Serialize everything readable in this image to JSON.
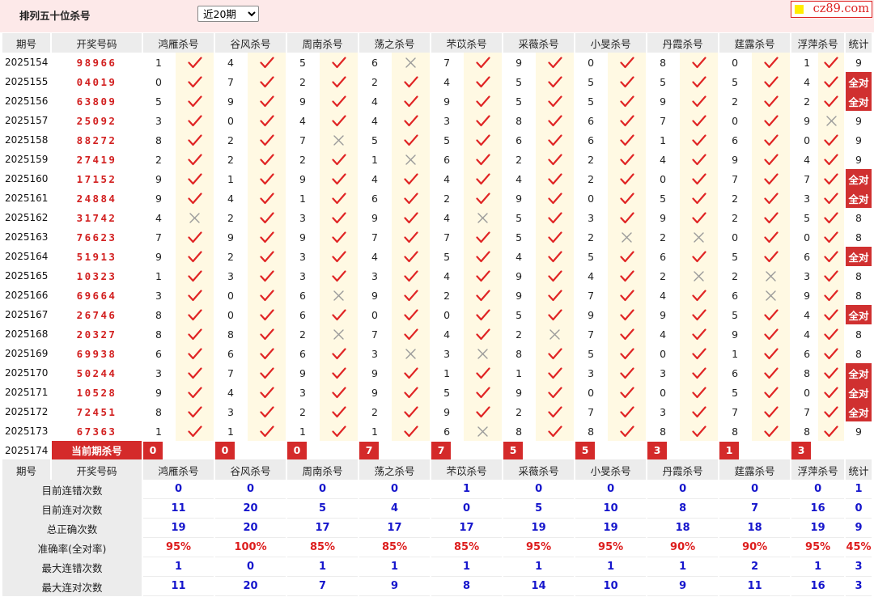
{
  "header": {
    "title": "排列五十位杀号",
    "range_select": "近20期",
    "logo": "cz89.com"
  },
  "table": {
    "col_qihao": "期号",
    "col_kaijiang": "开奖号码",
    "experts": [
      "鸿雁杀号",
      "谷风杀号",
      "周南杀号",
      "荡之杀号",
      "芣苡杀号",
      "采薇杀号",
      "小旻杀号",
      "丹霞杀号",
      "莛露杀号",
      "浮萍杀号"
    ],
    "col_stat": "统计",
    "all_correct_label": "全对",
    "rows": [
      {
        "issue": "2025154",
        "draw": "98966",
        "kills": [
          1,
          4,
          5,
          6,
          7,
          9,
          0,
          8,
          0,
          1
        ],
        "ok": [
          1,
          1,
          1,
          0,
          1,
          1,
          1,
          1,
          1,
          1
        ],
        "stat": "9"
      },
      {
        "issue": "2025155",
        "draw": "04019",
        "kills": [
          0,
          7,
          2,
          2,
          4,
          5,
          5,
          5,
          5,
          4
        ],
        "ok": [
          1,
          1,
          1,
          1,
          1,
          1,
          1,
          1,
          1,
          1
        ],
        "stat": "全对"
      },
      {
        "issue": "2025156",
        "draw": "63809",
        "kills": [
          5,
          9,
          9,
          4,
          9,
          5,
          5,
          9,
          2,
          2
        ],
        "ok": [
          1,
          1,
          1,
          1,
          1,
          1,
          1,
          1,
          1,
          1
        ],
        "stat": "全对"
      },
      {
        "issue": "2025157",
        "draw": "25092",
        "kills": [
          3,
          0,
          4,
          4,
          3,
          8,
          6,
          7,
          0,
          9
        ],
        "ok": [
          1,
          1,
          1,
          1,
          1,
          1,
          1,
          1,
          1,
          0
        ],
        "stat": "9"
      },
      {
        "issue": "2025158",
        "draw": "88272",
        "kills": [
          8,
          2,
          7,
          5,
          5,
          6,
          6,
          1,
          6,
          0
        ],
        "ok": [
          1,
          1,
          0,
          1,
          1,
          1,
          1,
          1,
          1,
          1
        ],
        "stat": "9"
      },
      {
        "issue": "2025159",
        "draw": "27419",
        "kills": [
          2,
          2,
          2,
          1,
          6,
          2,
          2,
          4,
          9,
          4
        ],
        "ok": [
          1,
          1,
          1,
          0,
          1,
          1,
          1,
          1,
          1,
          1
        ],
        "stat": "9"
      },
      {
        "issue": "2025160",
        "draw": "17152",
        "kills": [
          9,
          1,
          9,
          4,
          4,
          4,
          2,
          0,
          7,
          7
        ],
        "ok": [
          1,
          1,
          1,
          1,
          1,
          1,
          1,
          1,
          1,
          1
        ],
        "stat": "全对"
      },
      {
        "issue": "2025161",
        "draw": "24884",
        "kills": [
          9,
          4,
          1,
          6,
          2,
          9,
          0,
          5,
          2,
          3
        ],
        "ok": [
          1,
          1,
          1,
          1,
          1,
          1,
          1,
          1,
          1,
          1
        ],
        "stat": "全对"
      },
      {
        "issue": "2025162",
        "draw": "31742",
        "kills": [
          4,
          2,
          3,
          9,
          4,
          5,
          3,
          9,
          2,
          5
        ],
        "ok": [
          0,
          1,
          1,
          1,
          0,
          1,
          1,
          1,
          1,
          1
        ],
        "stat": "8"
      },
      {
        "issue": "2025163",
        "draw": "76623",
        "kills": [
          7,
          9,
          9,
          7,
          7,
          5,
          2,
          2,
          0,
          0
        ],
        "ok": [
          1,
          1,
          1,
          1,
          1,
          1,
          0,
          0,
          1,
          1
        ],
        "stat": "8"
      },
      {
        "issue": "2025164",
        "draw": "51913",
        "kills": [
          9,
          2,
          3,
          4,
          5,
          4,
          5,
          6,
          5,
          6
        ],
        "ok": [
          1,
          1,
          1,
          1,
          1,
          1,
          1,
          1,
          1,
          1
        ],
        "stat": "全对"
      },
      {
        "issue": "2025165",
        "draw": "10323",
        "kills": [
          1,
          3,
          3,
          3,
          4,
          9,
          4,
          2,
          2,
          3
        ],
        "ok": [
          1,
          1,
          1,
          1,
          1,
          1,
          1,
          0,
          0,
          1
        ],
        "stat": "8"
      },
      {
        "issue": "2025166",
        "draw": "69664",
        "kills": [
          3,
          0,
          6,
          9,
          2,
          9,
          7,
          4,
          6,
          9
        ],
        "ok": [
          1,
          1,
          0,
          1,
          1,
          1,
          1,
          1,
          0,
          1
        ],
        "stat": "8"
      },
      {
        "issue": "2025167",
        "draw": "26746",
        "kills": [
          8,
          0,
          6,
          0,
          0,
          5,
          9,
          9,
          5,
          4
        ],
        "ok": [
          1,
          1,
          1,
          1,
          1,
          1,
          1,
          1,
          1,
          1
        ],
        "stat": "全对"
      },
      {
        "issue": "2025168",
        "draw": "20327",
        "kills": [
          8,
          8,
          2,
          7,
          4,
          2,
          7,
          4,
          9,
          4
        ],
        "ok": [
          1,
          1,
          0,
          1,
          1,
          0,
          1,
          1,
          1,
          1
        ],
        "stat": "8"
      },
      {
        "issue": "2025169",
        "draw": "69938",
        "kills": [
          6,
          6,
          6,
          3,
          3,
          8,
          5,
          0,
          1,
          6
        ],
        "ok": [
          1,
          1,
          1,
          0,
          0,
          1,
          1,
          1,
          1,
          1
        ],
        "stat": "8"
      },
      {
        "issue": "2025170",
        "draw": "50244",
        "kills": [
          3,
          7,
          9,
          9,
          1,
          1,
          3,
          3,
          6,
          8
        ],
        "ok": [
          1,
          1,
          1,
          1,
          1,
          1,
          1,
          1,
          1,
          1
        ],
        "stat": "全对"
      },
      {
        "issue": "2025171",
        "draw": "10528",
        "kills": [
          9,
          4,
          3,
          9,
          5,
          9,
          0,
          0,
          5,
          0
        ],
        "ok": [
          1,
          1,
          1,
          1,
          1,
          1,
          1,
          1,
          1,
          1
        ],
        "stat": "全对"
      },
      {
        "issue": "2025172",
        "draw": "72451",
        "kills": [
          8,
          3,
          2,
          2,
          9,
          2,
          7,
          3,
          7,
          7
        ],
        "ok": [
          1,
          1,
          1,
          1,
          1,
          1,
          1,
          1,
          1,
          1
        ],
        "stat": "全对"
      },
      {
        "issue": "2025173",
        "draw": "67363",
        "kills": [
          1,
          1,
          1,
          1,
          6,
          8,
          8,
          8,
          8,
          8
        ],
        "ok": [
          1,
          1,
          1,
          1,
          0,
          1,
          1,
          1,
          1,
          1
        ],
        "stat": "9"
      }
    ],
    "current": {
      "issue": "2025174",
      "label": "当前期杀号",
      "kills": [
        "0",
        "0",
        "0",
        "7",
        "7",
        "5",
        "5",
        "3",
        "1",
        "3"
      ]
    }
  },
  "summary": [
    {
      "label": "目前连错次数",
      "values": [
        "0",
        "0",
        "0",
        "0",
        "1",
        "0",
        "0",
        "0",
        "0",
        "0"
      ],
      "stat": "1"
    },
    {
      "label": "目前连对次数",
      "values": [
        "11",
        "20",
        "5",
        "4",
        "0",
        "5",
        "10",
        "8",
        "7",
        "16"
      ],
      "stat": "0"
    },
    {
      "label": "总正确次数",
      "values": [
        "19",
        "20",
        "17",
        "17",
        "17",
        "19",
        "19",
        "18",
        "18",
        "19"
      ],
      "stat": "9"
    },
    {
      "label": "准确率(全对率)",
      "values": [
        "95%",
        "100%",
        "85%",
        "85%",
        "85%",
        "95%",
        "95%",
        "90%",
        "90%",
        "95%"
      ],
      "stat": "45%",
      "is_rate": true
    },
    {
      "label": "最大连错次数",
      "values": [
        "1",
        "0",
        "1",
        "1",
        "1",
        "1",
        "1",
        "1",
        "2",
        "1"
      ],
      "stat": "3"
    },
    {
      "label": "最大连对次数",
      "values": [
        "11",
        "20",
        "7",
        "9",
        "8",
        "14",
        "10",
        "9",
        "11",
        "16"
      ],
      "stat": "3"
    }
  ],
  "colors": {
    "accent_red": "#d42a2a",
    "blue_value": "#1515cc",
    "header_bg": "#ececec",
    "mark_bg": "#fff9e3",
    "top_bg": "#fde9e9"
  },
  "icons": {
    "correct": "check-icon",
    "wrong": "cross-icon"
  }
}
